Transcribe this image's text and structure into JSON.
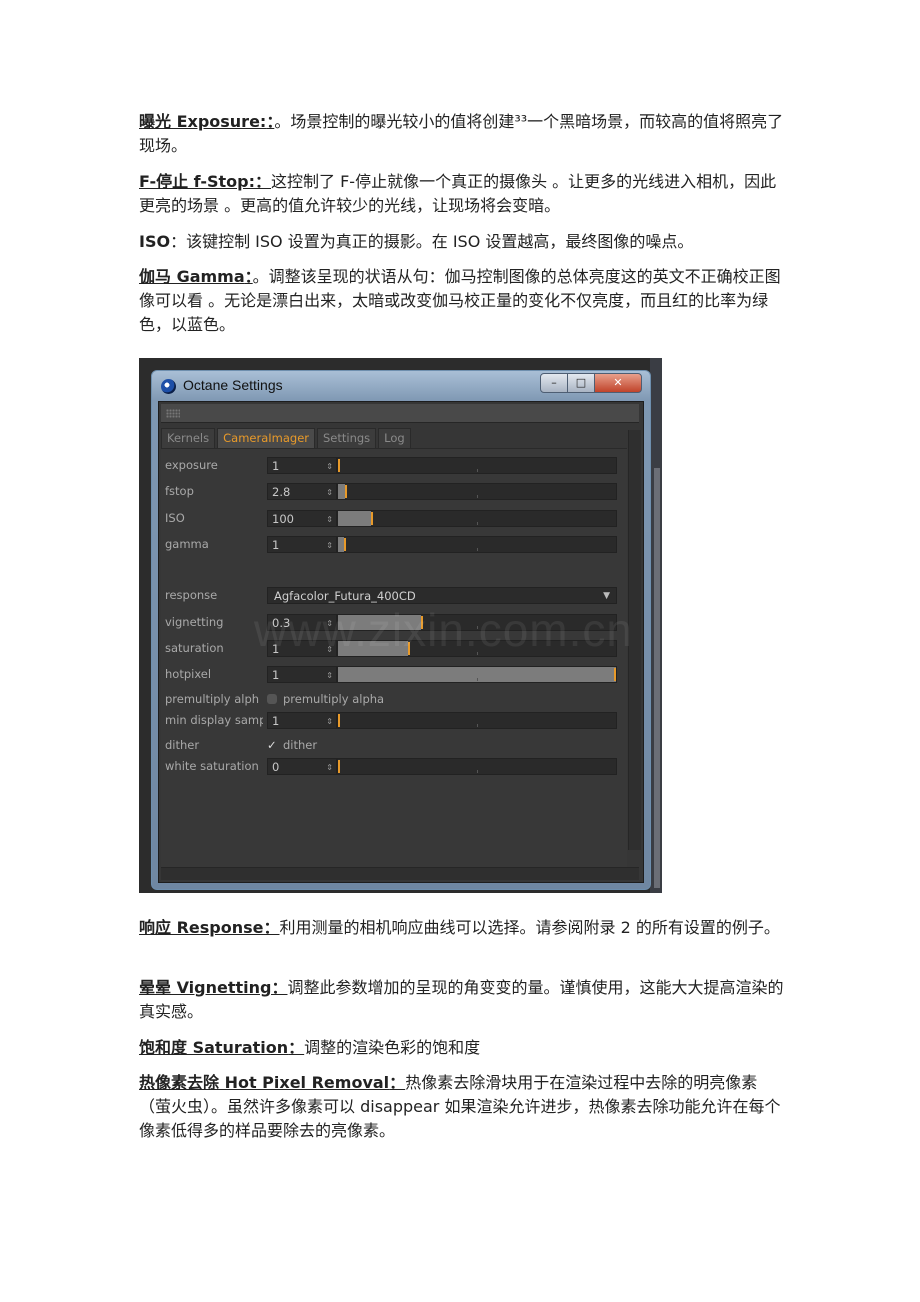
{
  "paragraphs_top": [
    {
      "term": "曝光 Exposure:",
      "punct": "：",
      "text": "。场景控制的曝光较小的值将创建³³一个黑暗场景，而较高的值将照亮了现场。"
    },
    {
      "term": "F-停止 f-Stop:",
      "punct": "：",
      "text": "这控制了 F-停止就像一个真正的摄像头 。让更多的光线进入相机，因此更亮的场景 。更高的值允许较少的光线，让现场将会变暗。"
    },
    {
      "term": "ISO",
      "punct": "：",
      "text": "该键控制 ISO 设置为真正的摄影。在 ISO 设置越高，最终图像的噪点。"
    },
    {
      "term": "伽马 Gamma",
      "punct": "：",
      "text": "。调整该呈现的状语从句：伽马控制图像的总体亮度这的英文不正确校正图像可以看 。无论是漂白出来，太暗或改变伽马校正量的变化不仅亮度，而且红的比率为绿色，以蓝色。"
    }
  ],
  "octane": {
    "window_title": "Octane Settings",
    "buttons": {
      "minimize": "–",
      "maximize": "□",
      "close": "✕"
    },
    "tabs": [
      "Kernels",
      "CameraImager",
      "Settings",
      "Log"
    ],
    "rows": [
      {
        "label": "exposure",
        "value": "1",
        "fraction": 0.0
      },
      {
        "label": "fstop",
        "value": "2.8",
        "fraction": 0.025
      },
      {
        "label": "ISO",
        "value": "100",
        "fraction": 0.12
      },
      {
        "label": "gamma",
        "value": "1",
        "fraction": 0.02
      },
      {
        "label": "vignetting",
        "value": "0.3",
        "fraction": 0.3
      },
      {
        "label": "saturation",
        "value": "1",
        "fraction": 0.25
      },
      {
        "label": "hotpixel",
        "value": "1",
        "fraction": 1.0
      },
      {
        "label": "min display samp",
        "value": "1",
        "fraction": 0.0
      },
      {
        "label": "white saturation",
        "value": "0",
        "fraction": 0.0
      }
    ],
    "response": {
      "label": "response",
      "value": "Agfacolor_Futura_400CD"
    },
    "premultiply": {
      "label": "premultiply alph",
      "text": "premultiply alpha",
      "checked": false
    },
    "dither": {
      "label": "dither",
      "text": "dither",
      "checked": true
    },
    "watermark": "www.zixin.com.cn",
    "accent_color": "#e89a2a"
  },
  "paragraphs_bottom": [
    {
      "term": "响应 Response",
      "punct": "：",
      "text": "利用测量的相机响应曲线可以选择。请参阅附录 2 的所有设置的例子。"
    },
    {
      "term": "晕晕 Vignetting",
      "punct": "：",
      "text": "调整此参数增加的呈现的角变变的量。谨慎使用，这能大大提高渲染的真实感。"
    },
    {
      "term": "饱和度 Saturation",
      "punct": "：",
      "text": "调整的渲染色彩的饱和度"
    },
    {
      "term": "热像素去除 Hot Pixel Removal",
      "punct": "：",
      "text": "热像素去除滑块用于在渲染过程中去除的明亮像素（萤火虫）。虽然许多像素可以 disappear 如果渲染允许进步，热像素去除功能允许在每个像素低得多的样品要除去的亮像素。"
    }
  ]
}
